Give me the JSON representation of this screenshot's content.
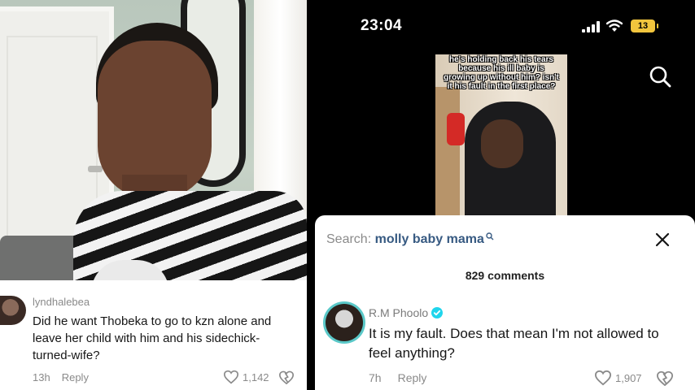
{
  "left_panel": {
    "comment": {
      "username": "lyndhalebea",
      "text": "Did he want Thobeka to go to kzn alone and leave her child with him and his sidechick-turned-wife?",
      "time": "13h",
      "reply_label": "Reply",
      "like_count": "1,142",
      "icons": [
        "heart-icon",
        "dislike-icon"
      ]
    }
  },
  "right_panel": {
    "status_bar": {
      "time": "23:04",
      "battery": "13",
      "icons": [
        "signal-icon",
        "wifi-icon",
        "battery-icon"
      ]
    },
    "video": {
      "overlay_text": "he's holding back his tears because his ill baby is growing up without him? isn't it his fault in the first place?"
    },
    "comments_sheet": {
      "search_prefix": "Search:",
      "search_term": "molly baby mama",
      "comment_count": "829 comments",
      "comment": {
        "username": "R.M Phoolo",
        "text": "It is my fault. Does that mean I'm not allowed to feel anything?",
        "time": "7h",
        "reply_label": "Reply",
        "like_count": "1,907"
      },
      "icons": [
        "search-icon",
        "close-icon",
        "verified-icon",
        "heart-icon",
        "dislike-icon"
      ]
    }
  },
  "colors": {
    "search_term": "#375a82",
    "battery": "#f2c53d",
    "avatar_ring": "#5ac8c8",
    "verified": "#20d5ec"
  }
}
